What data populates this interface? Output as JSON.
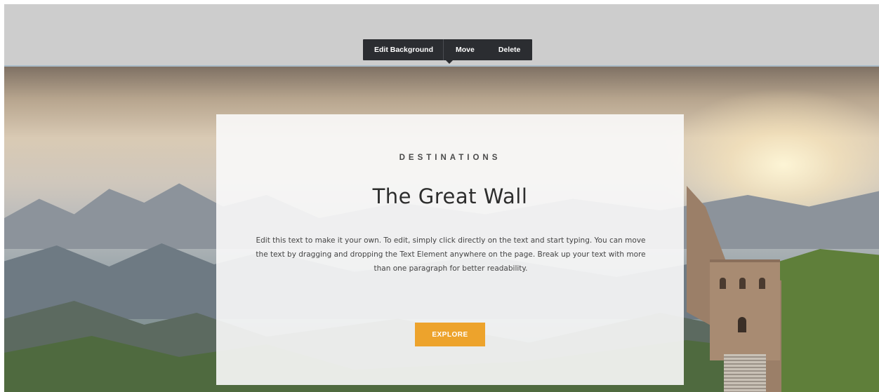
{
  "toolbar": {
    "items": [
      {
        "label": "Edit Background"
      },
      {
        "label": "Move"
      },
      {
        "label": "Delete"
      }
    ],
    "background_color": "#2b2d31"
  },
  "section": {
    "kicker": "DESTINATIONS",
    "title": "The Great Wall",
    "body": "Edit this text to make it your own. To edit, simply click directly on the text and start typing. You can move the text by dragging and dropping the Text Element anywhere on the page. Break up your text with more than one paragraph for better readability.",
    "button_label": "EXPLORE",
    "button_color": "#eda32c",
    "background_image": "great-wall-landscape"
  }
}
